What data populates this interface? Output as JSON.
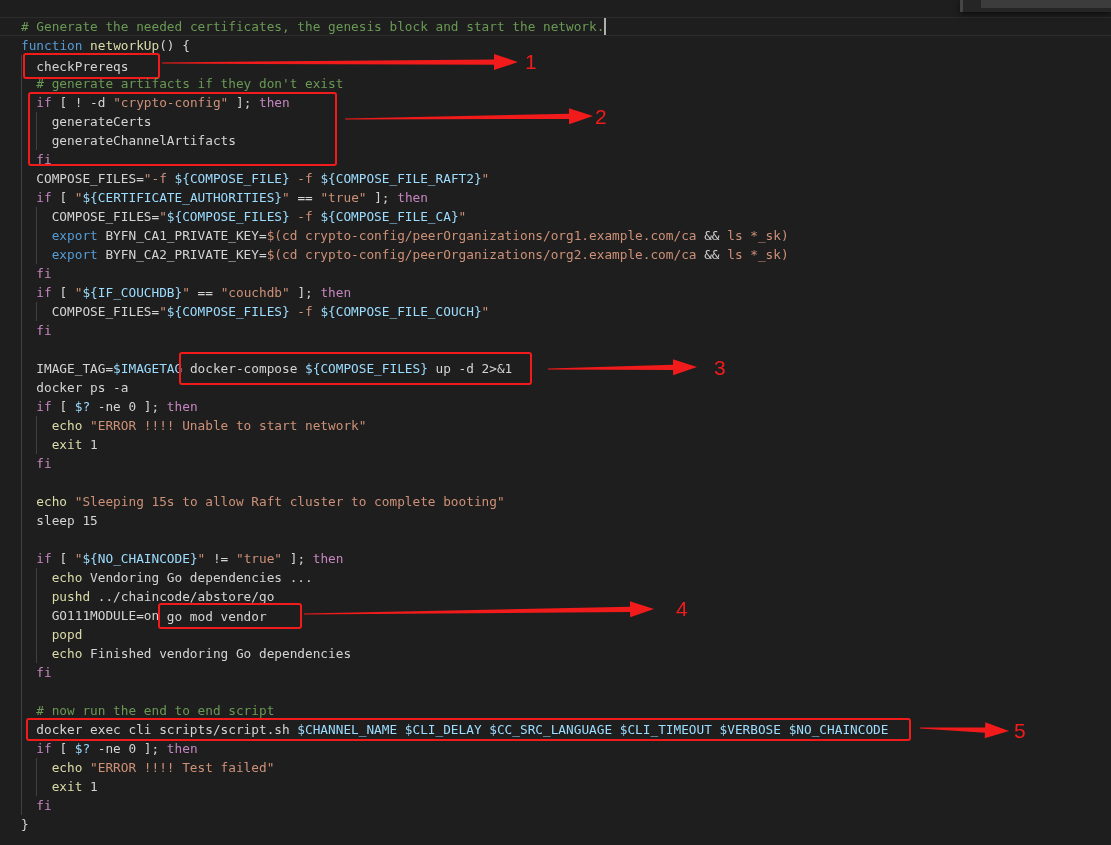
{
  "editor": {
    "lines": [
      {
        "current": true,
        "tokens": [
          {
            "kind": "comment",
            "text": "# Generate the needed certificates, the genesis block and start the network."
          }
        ]
      },
      {
        "current": false,
        "tokens": [
          {
            "kind": "storage",
            "text": "function"
          },
          {
            "kind": "function",
            "text": " networkUp"
          },
          {
            "kind": "plain",
            "text": "() {"
          }
        ]
      },
      {
        "current": false,
        "tokens": [
          {
            "kind": "plain",
            "text": "  checkPrereqs"
          }
        ]
      },
      {
        "current": false,
        "tokens": [
          {
            "kind": "comment",
            "text": "  # generate artifacts if they don't exist"
          }
        ]
      },
      {
        "current": false,
        "tokens": [
          {
            "kind": "keyword",
            "text": "  if"
          },
          {
            "kind": "plain",
            "text": " [ ! -d "
          },
          {
            "kind": "string",
            "text": "\"crypto-config\""
          },
          {
            "kind": "plain",
            "text": " ]; "
          },
          {
            "kind": "keyword",
            "text": "then"
          }
        ]
      },
      {
        "current": false,
        "tokens": [
          {
            "kind": "plain",
            "text": "    generateCerts"
          }
        ]
      },
      {
        "current": false,
        "tokens": [
          {
            "kind": "plain",
            "text": "    generateChannelArtifacts"
          }
        ]
      },
      {
        "current": false,
        "tokens": [
          {
            "kind": "keyword",
            "text": "  fi"
          }
        ]
      },
      {
        "current": false,
        "tokens": [
          {
            "kind": "plain",
            "text": "  COMPOSE_FILES="
          },
          {
            "kind": "string",
            "text": "\"-f "
          },
          {
            "kind": "variable",
            "text": "${COMPOSE_FILE}"
          },
          {
            "kind": "string",
            "text": " -f "
          },
          {
            "kind": "variable",
            "text": "${COMPOSE_FILE_RAFT2}"
          },
          {
            "kind": "string",
            "text": "\""
          }
        ]
      },
      {
        "current": false,
        "tokens": [
          {
            "kind": "keyword",
            "text": "  if"
          },
          {
            "kind": "plain",
            "text": " [ "
          },
          {
            "kind": "string",
            "text": "\""
          },
          {
            "kind": "variable",
            "text": "${CERTIFICATE_AUTHORITIES}"
          },
          {
            "kind": "string",
            "text": "\""
          },
          {
            "kind": "plain",
            "text": " == "
          },
          {
            "kind": "string",
            "text": "\"true\""
          },
          {
            "kind": "plain",
            "text": " ]; "
          },
          {
            "kind": "keyword",
            "text": "then"
          }
        ]
      },
      {
        "current": false,
        "tokens": [
          {
            "kind": "plain",
            "text": "    COMPOSE_FILES="
          },
          {
            "kind": "string",
            "text": "\""
          },
          {
            "kind": "variable",
            "text": "${COMPOSE_FILES}"
          },
          {
            "kind": "string",
            "text": " -f "
          },
          {
            "kind": "variable",
            "text": "${COMPOSE_FILE_CA}"
          },
          {
            "kind": "string",
            "text": "\""
          }
        ]
      },
      {
        "current": false,
        "tokens": [
          {
            "kind": "storage",
            "text": "    export"
          },
          {
            "kind": "plain",
            "text": " BYFN_CA1_PRIVATE_KEY="
          },
          {
            "kind": "string",
            "text": "$(cd crypto-config/peerOrganizations/org1.example.com/ca "
          },
          {
            "kind": "plain",
            "text": "&&"
          },
          {
            "kind": "string",
            "text": " ls *_sk)"
          }
        ]
      },
      {
        "current": false,
        "tokens": [
          {
            "kind": "storage",
            "text": "    export"
          },
          {
            "kind": "plain",
            "text": " BYFN_CA2_PRIVATE_KEY="
          },
          {
            "kind": "string",
            "text": "$(cd crypto-config/peerOrganizations/org2.example.com/ca "
          },
          {
            "kind": "plain",
            "text": "&&"
          },
          {
            "kind": "string",
            "text": " ls *_sk)"
          }
        ]
      },
      {
        "current": false,
        "tokens": [
          {
            "kind": "keyword",
            "text": "  fi"
          }
        ]
      },
      {
        "current": false,
        "tokens": [
          {
            "kind": "keyword",
            "text": "  if"
          },
          {
            "kind": "plain",
            "text": " [ "
          },
          {
            "kind": "string",
            "text": "\""
          },
          {
            "kind": "variable",
            "text": "${IF_COUCHDB}"
          },
          {
            "kind": "string",
            "text": "\""
          },
          {
            "kind": "plain",
            "text": " == "
          },
          {
            "kind": "string",
            "text": "\"couchdb\""
          },
          {
            "kind": "plain",
            "text": " ]; "
          },
          {
            "kind": "keyword",
            "text": "then"
          }
        ]
      },
      {
        "current": false,
        "tokens": [
          {
            "kind": "plain",
            "text": "    COMPOSE_FILES="
          },
          {
            "kind": "string",
            "text": "\""
          },
          {
            "kind": "variable",
            "text": "${COMPOSE_FILES}"
          },
          {
            "kind": "string",
            "text": " -f "
          },
          {
            "kind": "variable",
            "text": "${COMPOSE_FILE_COUCH}"
          },
          {
            "kind": "string",
            "text": "\""
          }
        ]
      },
      {
        "current": false,
        "tokens": [
          {
            "kind": "keyword",
            "text": "  fi"
          }
        ]
      },
      {
        "current": false
      },
      {
        "current": false,
        "tokens": [
          {
            "kind": "plain",
            "text": "  IMAGE_TAG="
          },
          {
            "kind": "variable",
            "text": "$IMAGETAG"
          },
          {
            "kind": "plain",
            "text": " docker-compose "
          },
          {
            "kind": "variable",
            "text": "${COMPOSE_FILES}"
          },
          {
            "kind": "plain",
            "text": " up -d 2>&1"
          }
        ]
      },
      {
        "current": false,
        "tokens": [
          {
            "kind": "plain",
            "text": "  docker ps -a"
          }
        ]
      },
      {
        "current": false,
        "tokens": [
          {
            "kind": "keyword",
            "text": "  if"
          },
          {
            "kind": "plain",
            "text": " [ "
          },
          {
            "kind": "variable",
            "text": "$?"
          },
          {
            "kind": "plain",
            "text": " -ne 0 ]; "
          },
          {
            "kind": "keyword",
            "text": "then"
          }
        ]
      },
      {
        "current": false,
        "tokens": [
          {
            "kind": "builtin",
            "text": "    echo"
          },
          {
            "kind": "string",
            "text": " \"ERROR !!!! Unable to start network\""
          }
        ]
      },
      {
        "current": false,
        "tokens": [
          {
            "kind": "builtin",
            "text": "    exit"
          },
          {
            "kind": "plain",
            "text": " 1"
          }
        ]
      },
      {
        "current": false,
        "tokens": [
          {
            "kind": "keyword",
            "text": "  fi"
          }
        ]
      },
      {
        "current": false
      },
      {
        "current": false,
        "tokens": [
          {
            "kind": "builtin",
            "text": "  echo"
          },
          {
            "kind": "string",
            "text": " \"Sleeping 15s to allow Raft cluster to complete booting\""
          }
        ]
      },
      {
        "current": false,
        "tokens": [
          {
            "kind": "plain",
            "text": "  sleep 15"
          }
        ]
      },
      {
        "current": false
      },
      {
        "current": false,
        "tokens": [
          {
            "kind": "keyword",
            "text": "  if"
          },
          {
            "kind": "plain",
            "text": " [ "
          },
          {
            "kind": "string",
            "text": "\""
          },
          {
            "kind": "variable",
            "text": "${NO_CHAINCODE}"
          },
          {
            "kind": "string",
            "text": "\""
          },
          {
            "kind": "plain",
            "text": " != "
          },
          {
            "kind": "string",
            "text": "\"true\""
          },
          {
            "kind": "plain",
            "text": " ]; "
          },
          {
            "kind": "keyword",
            "text": "then"
          }
        ]
      },
      {
        "current": false,
        "tokens": [
          {
            "kind": "builtin",
            "text": "    echo"
          },
          {
            "kind": "plain",
            "text": " Vendoring Go dependencies ..."
          }
        ]
      },
      {
        "current": false,
        "tokens": [
          {
            "kind": "builtin",
            "text": "    pushd"
          },
          {
            "kind": "plain",
            "text": " ../chaincode/abstore/go"
          }
        ]
      },
      {
        "current": false,
        "tokens": [
          {
            "kind": "plain",
            "text": "    GO111MODULE=on"
          },
          {
            "kind": "plain",
            "text": " go mod vendor"
          }
        ]
      },
      {
        "current": false,
        "tokens": [
          {
            "kind": "builtin",
            "text": "    popd"
          }
        ]
      },
      {
        "current": false,
        "tokens": [
          {
            "kind": "builtin",
            "text": "    echo"
          },
          {
            "kind": "plain",
            "text": " Finished vendoring Go dependencies"
          }
        ]
      },
      {
        "current": false,
        "tokens": [
          {
            "kind": "keyword",
            "text": "  fi"
          }
        ]
      },
      {
        "current": false
      },
      {
        "current": false,
        "tokens": [
          {
            "kind": "comment",
            "text": "  # now run the end to end script"
          }
        ]
      },
      {
        "current": false,
        "tokens": [
          {
            "kind": "plain",
            "text": "  docker exec cli scripts/script.sh "
          },
          {
            "kind": "variable",
            "text": "$CHANNEL_NAME"
          },
          {
            "kind": "variable",
            "text": " $CLI_DELAY"
          },
          {
            "kind": "variable",
            "text": " $CC_SRC_LANGUAGE"
          },
          {
            "kind": "variable",
            "text": " $CLI_TIMEOUT"
          },
          {
            "kind": "variable",
            "text": " $VERBOSE"
          },
          {
            "kind": "variable",
            "text": " $NO_CHAINCODE"
          }
        ]
      },
      {
        "current": false,
        "tokens": [
          {
            "kind": "keyword",
            "text": "  if"
          },
          {
            "kind": "plain",
            "text": " [ "
          },
          {
            "kind": "variable",
            "text": "$?"
          },
          {
            "kind": "plain",
            "text": " -ne 0 ]; "
          },
          {
            "kind": "keyword",
            "text": "then"
          }
        ]
      },
      {
        "current": false,
        "tokens": [
          {
            "kind": "builtin",
            "text": "    echo"
          },
          {
            "kind": "string",
            "text": " \"ERROR !!!! Test failed\""
          }
        ]
      },
      {
        "current": false,
        "tokens": [
          {
            "kind": "builtin",
            "text": "    exit"
          },
          {
            "kind": "plain",
            "text": " 1"
          }
        ]
      },
      {
        "current": false,
        "tokens": [
          {
            "kind": "keyword",
            "text": "  fi"
          }
        ]
      },
      {
        "current": false,
        "tokens": [
          {
            "kind": "plain",
            "text": "}"
          }
        ]
      }
    ]
  },
  "annotations": [
    {
      "number": "1"
    },
    {
      "number": "2"
    },
    {
      "number": "3"
    },
    {
      "number": "4"
    },
    {
      "number": "5"
    }
  ]
}
